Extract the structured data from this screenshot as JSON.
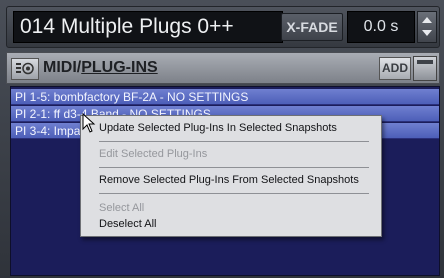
{
  "header": {
    "snapshot_name": "014 Multiple Plugs 0++",
    "xfade_label": "X-FADE",
    "xfade_value": "0.0 s"
  },
  "section": {
    "title_prefix": "MIDI/",
    "title_main": "PLUG-INS",
    "add_label": "ADD"
  },
  "plugins": [
    {
      "label": "PI 1-5: bombfactory BF-2A - NO SETTINGS"
    },
    {
      "label": "PI 2-1: ff d3-4 Band - NO SETTINGS"
    },
    {
      "label": "PI 3-4: Impact"
    }
  ],
  "context_menu": {
    "update": "Update Selected Plug-Ins In Selected Snapshots",
    "edit": "Edit Selected Plug-Ins",
    "remove": "Remove Selected Plug-Ins From Selected Snapshots",
    "select_all": "Select All",
    "deselect_all": "Deselect All"
  }
}
